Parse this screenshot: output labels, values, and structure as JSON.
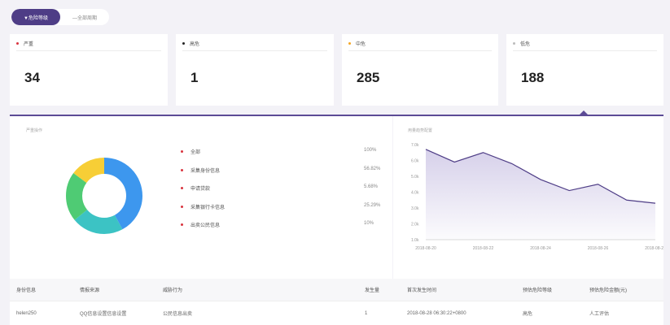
{
  "view_toggle": {
    "options": [
      {
        "label": "▼危险等级",
        "active": true
      },
      {
        "label": "—全部周期",
        "active": false
      }
    ]
  },
  "stat_cards": [
    {
      "label": "严重",
      "value": "34",
      "dot_color": "#d9343f"
    },
    {
      "label": "高危",
      "value": "1",
      "dot_color": "#222222"
    },
    {
      "label": "中危",
      "value": "285",
      "dot_color": "#f5a623"
    },
    {
      "label": "低危",
      "value": "188",
      "dot_color": "#bbbbbb"
    }
  ],
  "panels": {
    "left_title": "严重操作",
    "right_title": "用量趋势配置"
  },
  "legend": [
    {
      "label": "全部",
      "value": "100%"
    },
    {
      "label": "采集身份信息",
      "value": "56.82%"
    },
    {
      "label": "申请贷款",
      "value": "5.68%"
    },
    {
      "label": "采集银行卡信息",
      "value": "25.29%"
    },
    {
      "label": "出卖公民信息",
      "value": "10%"
    }
  ],
  "chart_data": [
    {
      "type": "pie",
      "categories": [
        "采集身份信息",
        "申请贷款",
        "采集银行卡信息",
        "出卖公民信息"
      ],
      "values": [
        42,
        22,
        21,
        15
      ],
      "colors": [
        "#3d97ee",
        "#3cc3c4",
        "#4fcb74",
        "#f7ce36"
      ],
      "donut": true
    },
    {
      "type": "area",
      "x": [
        "2018-08-20",
        "2018-08-21",
        "2018-08-22",
        "2018-08-23",
        "2018-08-24",
        "2018-08-25",
        "2018-08-26",
        "2018-08-27",
        "2018-08-28"
      ],
      "x_tick_labels": [
        "2018-08-20",
        "2018-08-22",
        "2018-08-24",
        "2018-08-26",
        "2018-08-28"
      ],
      "series": [
        {
          "values": [
            6.7,
            5.9,
            6.5,
            5.8,
            4.8,
            4.1,
            4.5,
            3.5,
            3.3
          ]
        }
      ],
      "y_tick_labels": [
        "7.0k",
        "6.0k",
        "5.0k",
        "4.0k",
        "3.0k",
        "2.0k",
        "1.0k"
      ],
      "ylim": [
        1,
        7
      ],
      "line_color": "#4e3d86",
      "fill_color": "#d6d0ea"
    }
  ],
  "table": {
    "headers": [
      "身份信息",
      "情报来源",
      "威胁行为",
      "发生量",
      "首次发生时间",
      "预估危险等级",
      "预估危险金额(元)"
    ],
    "rows": [
      [
        "helen250",
        "QQ信息设置信息设置",
        "公民信息出卖",
        "1",
        "2018-08-28 06:30:22+0800",
        "高危",
        "人工评估"
      ]
    ]
  }
}
